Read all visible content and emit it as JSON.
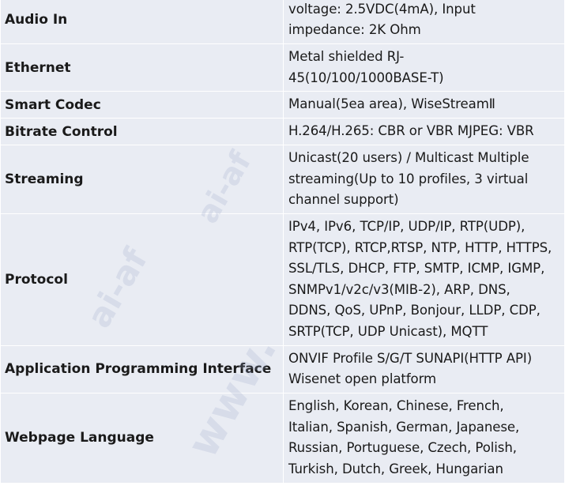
{
  "rows": [
    {
      "label": "Audio In",
      "value": "voltage: 2.5VDC(4mA), Input\nimpedance: 2K Ohm"
    },
    {
      "label": "Ethernet",
      "value": "Metal shielded RJ-\n45(10/100/1000BASE-T)"
    },
    {
      "label": "Smart Codec",
      "value": "Manual(5ea area), WiseStreamⅡ"
    },
    {
      "label": "Bitrate Control",
      "value": "H.264/H.265: CBR or VBR MJPEG: VBR"
    },
    {
      "label": "Streaming",
      "value": "Unicast(20 users) / Multicast Multiple\nstreaming(Up to 10 profiles, 3 virtual\nchannel support)"
    },
    {
      "label": "Protocol",
      "value": "IPv4, IPv6, TCP/IP, UDP/IP, RTP(UDP),\nRTP(TCP), RTCP,RTSP, NTP, HTTP, HTTPS,\nSSL/TLS, DHCP, FTP, SMTP, ICMP, IGMP,\nSNMPv1/v2c/v3(MIB-2), ARP, DNS,\nDDNS, QoS, UPnP, Bonjour, LLDP, CDP,\nSRTP(TCP, UDP Unicast), MQTT"
    },
    {
      "label": "Application Programming Interface",
      "value": "ONVIF Profile S/G/T SUNAPI(HTTP API)\nWisenet open platform"
    },
    {
      "label": "Webpage Language",
      "value": "English, Korean, Chinese, French,\nItalian, Spanish, German, Japanese,\nRussian, Portuguese, Czech, Polish,\nTurkish, Dutch, Greek, Hungarian"
    }
  ],
  "watermark": {
    "text": "ai-af",
    "text2": "www."
  }
}
